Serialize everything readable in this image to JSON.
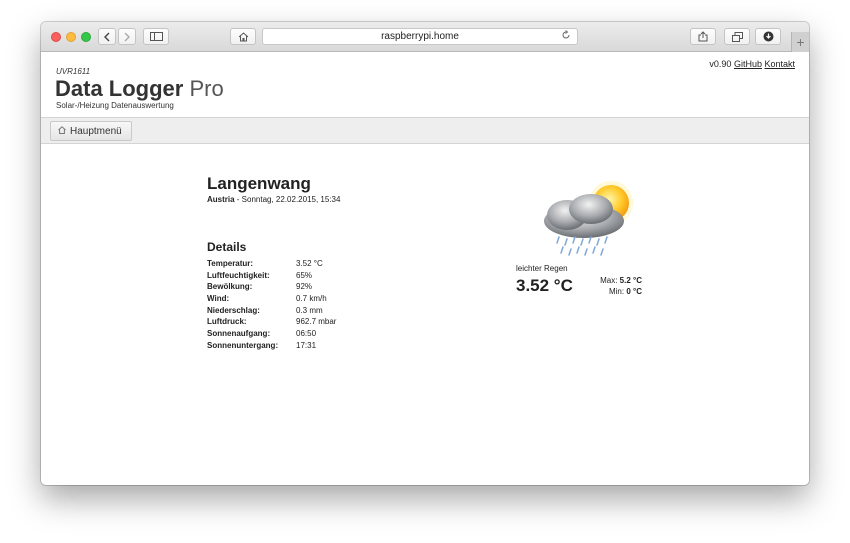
{
  "browser": {
    "url": "raspberrypi.home",
    "icons": {
      "back": "chevron-left-icon",
      "forward": "chevron-right-icon",
      "sidebar": "sidebar-icon",
      "home": "home-icon",
      "reload": "reload-icon",
      "share": "share-icon",
      "tabs": "tabs-icon",
      "downloads": "download-icon",
      "new_tab": "plus-icon"
    }
  },
  "header": {
    "version": "v0.90",
    "github_link": "GitHub",
    "contact_link": "Kontakt",
    "brand_small": "UVR1611",
    "brand_title_bold": "Data Logger",
    "brand_title_light": "Pro",
    "brand_subtitle": "Solar-/Heizung Datenauswertung"
  },
  "nav": {
    "main_menu_label": "Hauptmenü",
    "main_menu_icon": "home-icon"
  },
  "location": {
    "city": "Langenwang",
    "country": "Austria",
    "datetime": "- Sonntag, 22.02.2015, 15:34"
  },
  "details": {
    "title": "Details",
    "rows": [
      {
        "label": "Temperatur:",
        "value": "3.52 °C"
      },
      {
        "label": "Luftfeuchtigkeit:",
        "value": "65%"
      },
      {
        "label": "Bewölkung:",
        "value": "92%"
      },
      {
        "label": "Wind:",
        "value": "0.7 km/h"
      },
      {
        "label": "Niederschlag:",
        "value": "0.3 mm"
      },
      {
        "label": "Luftdruck:",
        "value": "962.7 mbar"
      },
      {
        "label": "Sonnenaufgang:",
        "value": "06:50"
      },
      {
        "label": "Sonnenuntergang:",
        "value": "17:31"
      }
    ]
  },
  "current": {
    "icon": "sun-cloud-rain-icon",
    "condition": "leichter Regen",
    "temperature": "3.52 °C",
    "max_label": "Max:",
    "max_value": "5.2 °C",
    "min_label": "Min:",
    "min_value": "0 °C"
  }
}
